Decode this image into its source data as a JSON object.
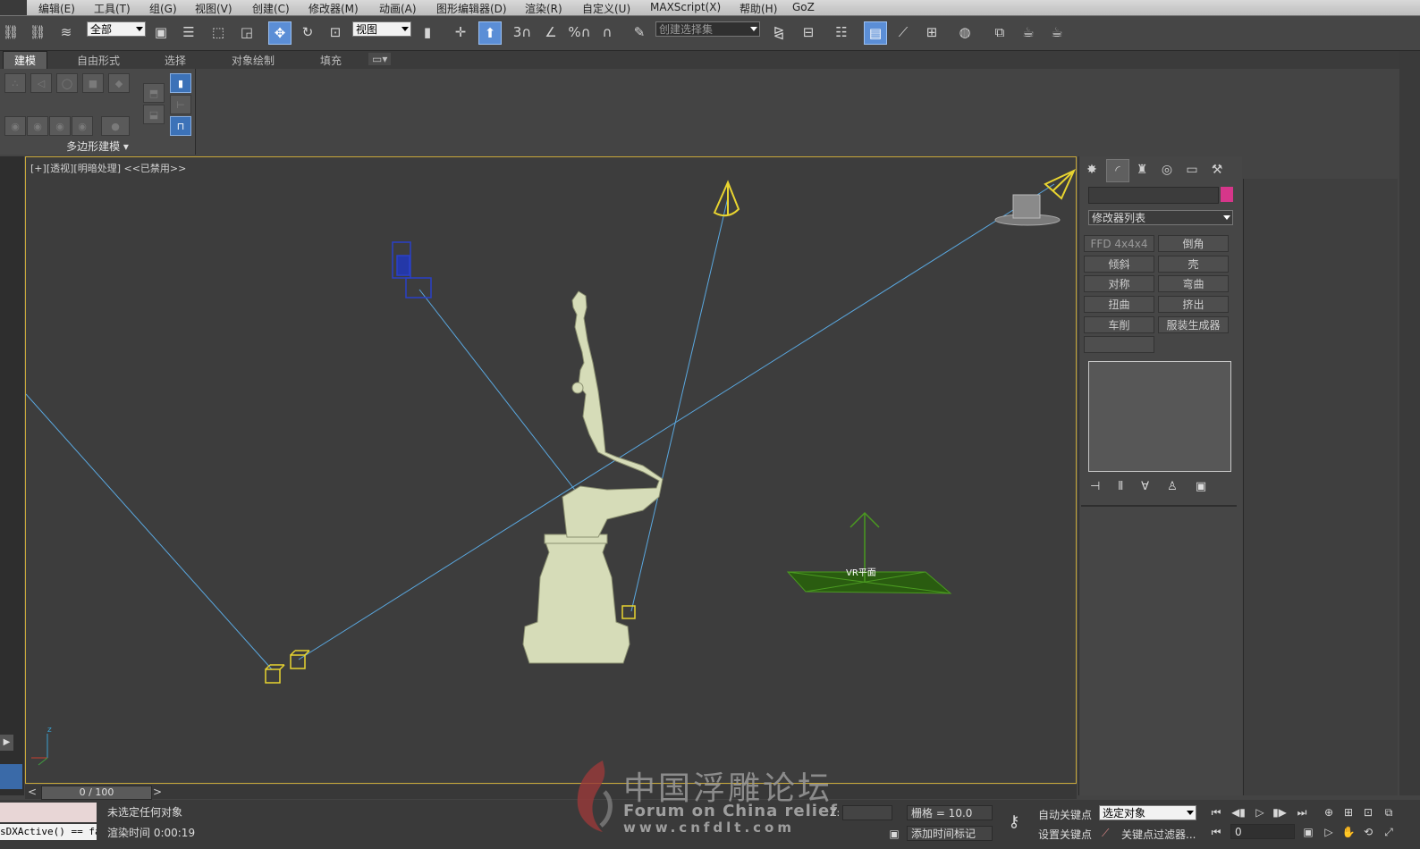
{
  "menu": [
    "编辑(E)",
    "工具(T)",
    "组(G)",
    "视图(V)",
    "创建(C)",
    "修改器(M)",
    "动画(A)",
    "图形编辑器(D)",
    "渲染(R)",
    "自定义(U)",
    "MAXScript(X)",
    "帮助(H)",
    "GoZ"
  ],
  "toolbar": {
    "filter_value": "全部",
    "refcoord_value": "视图",
    "selset_placeholder": "创建选择集",
    "snap_label": "3",
    "percent_label": "%"
  },
  "ribbon": {
    "tabs": [
      "建模",
      "自由形式",
      "选择",
      "对象绘制",
      "填充"
    ],
    "panel_label": "多边形建模 ▾"
  },
  "viewport": {
    "label_plus": "[+]",
    "label_view": "[透视]",
    "label_shading": "[明暗处理]",
    "label_disabled": "<<已禁用>>",
    "vr_plane_label": "VR平面",
    "axis_z": "z"
  },
  "command_panel": {
    "modifier_list": "修改器列表",
    "modifiers": [
      "FFD 4x4x4",
      "倒角",
      "倾斜",
      "壳",
      "对称",
      "弯曲",
      "扭曲",
      "挤出",
      "车削",
      "服装生成器"
    ],
    "name_color": "#d6368a"
  },
  "timeline": {
    "slider": "0 / 100",
    "prev": "<",
    "next": ">"
  },
  "status": {
    "script_line": "sDXActive() == fa",
    "selection": "未选定任何对象",
    "render_time": "渲染时间  0:00:19",
    "z_label": "Z:",
    "grid": "栅格 = 10.0",
    "add_time_tag": "添加时间标记",
    "auto_key": "自动关键点",
    "set_key": "设置关键点",
    "selected_object": "选定对象",
    "key_filter": "关键点过滤器...",
    "frame": "0"
  },
  "watermark": {
    "cn": "中国浮雕论坛",
    "en": "Forum on China relief",
    "url": "www.cnfdlt.com"
  },
  "colors": {
    "viewport_border": "#c9a93a",
    "wire": "#5aa8e0",
    "light": "#e8d430",
    "vr_plane": "#2a5c10",
    "statue": "#d6dcb8"
  }
}
